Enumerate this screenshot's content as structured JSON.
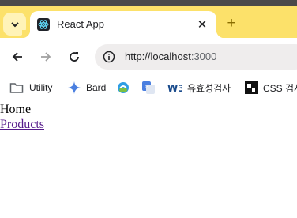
{
  "browser": {
    "tab": {
      "title": "React App",
      "favicon": "react-logo-icon",
      "close_glyph": "✕"
    },
    "new_tab_glyph": "+",
    "toolbar": {
      "back_icon": "back-arrow-icon",
      "forward_icon": "forward-arrow-icon",
      "reload_icon": "reload-icon",
      "site_info_icon": "info-icon",
      "url_host": "http://localhost",
      "url_port": ":3000"
    },
    "bookmarks": [
      {
        "label": "Utility",
        "icon": "folder-icon"
      },
      {
        "label": "Bard",
        "icon": "sparkle-icon"
      },
      {
        "label": "",
        "icon": "bookmark-favicon-1"
      },
      {
        "label": "",
        "icon": "google-translate-icon"
      },
      {
        "label": "유효성검사",
        "icon": "w3c-icon"
      },
      {
        "label": "CSS 검사",
        "icon": "css-tool-icon"
      }
    ]
  },
  "page": {
    "home_text": "Home",
    "products_link": "Products"
  },
  "colors": {
    "tab_bar": "#fce16a",
    "visited_link": "#551a8b"
  }
}
